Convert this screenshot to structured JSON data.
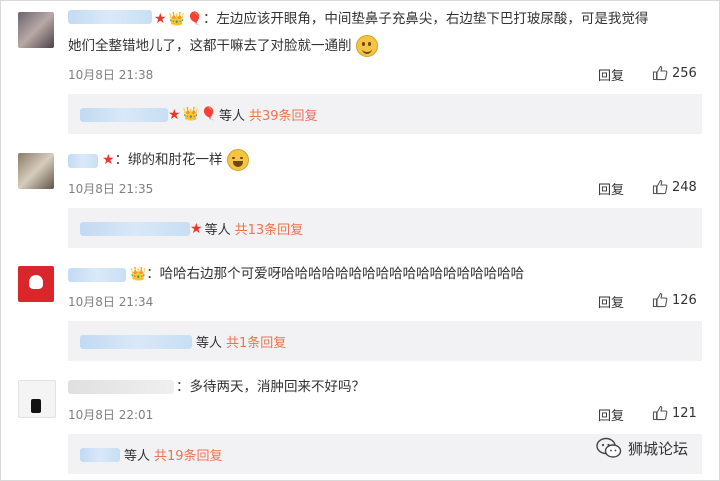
{
  "comments": [
    {
      "text_line1": "：左边应该开眼角，中间垫鼻子充鼻尖，右边垫下巴打玻尿酸，可是我觉得",
      "text_line2": "她们全整错地儿了，这都干嘛去了对脸就一通削",
      "time": "10月8日 21:38",
      "reply_label": "回复",
      "likes": "256",
      "sub_mid": "等人",
      "sub_count": "共39条回复",
      "emoji": "smile-emoji"
    },
    {
      "text_line1": "：绑的和肘花一样",
      "time": "10月8日 21:35",
      "reply_label": "回复",
      "likes": "248",
      "sub_mid": "等人",
      "sub_count": "共13条回复",
      "emoji": "laugh-cry-emoji"
    },
    {
      "text_line1": "：哈哈右边那个可爱呀哈哈哈哈哈哈哈哈哈哈哈哈哈哈哈哈哈哈",
      "time": "10月8日 21:34",
      "reply_label": "回复",
      "likes": "126",
      "sub_mid": "等人",
      "sub_count": "共1条回复"
    },
    {
      "text_line1": "：多待两天，消肿回来不好吗？",
      "time": "10月8日 22:01",
      "reply_label": "回复",
      "likes": "121",
      "sub_mid": "等人",
      "sub_count": "共19条回复"
    }
  ],
  "watermark": {
    "text": "狮城论坛",
    "icon": "wechat-icon"
  },
  "colors": {
    "link": "#eb7350",
    "star": "#e8362a",
    "subbox": "#f2f2f5"
  }
}
